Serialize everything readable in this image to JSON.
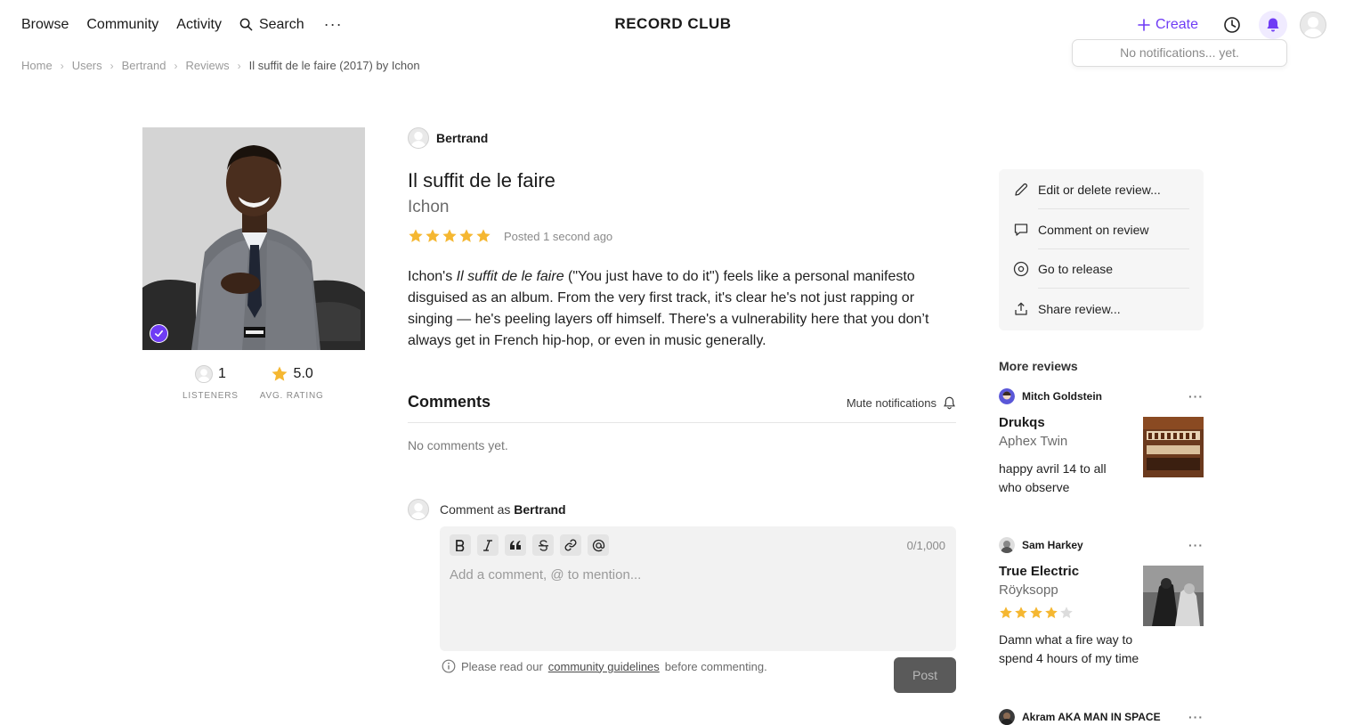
{
  "nav": {
    "browse": "Browse",
    "community": "Community",
    "activity": "Activity",
    "search": "Search",
    "more": "···",
    "logo": "RECORD CLUB",
    "create": "Create",
    "accent": "#6f3cf5"
  },
  "notifications": {
    "empty_text": "No notifications... yet."
  },
  "breadcrumb": {
    "home": "Home",
    "users": "Users",
    "user": "Bertrand",
    "reviews": "Reviews",
    "current": "Il suffit de le faire (2017) by Ichon"
  },
  "release": {
    "stats": {
      "listeners_count": "1",
      "listeners_label": "LISTENERS",
      "avg_rating": "5.0",
      "avg_rating_label": "AVG. RATING"
    }
  },
  "review": {
    "author": "Bertrand",
    "title": "Il suffit de le faire",
    "artist": "Ichon",
    "stars": 5,
    "posted": "Posted 1 second ago",
    "body_prefix": "Ichon's ",
    "body_italic": "Il suffit de le faire",
    "body_rest": " (\"You just have to do it\") feels like a personal manifesto disguised as an album. From the very first track, it's clear he's not just rapping or singing — he's peeling layers off himself. There's a vulnerability here that you don’t always get in French hip-hop, or even in music generally."
  },
  "comments": {
    "heading": "Comments",
    "mute": "Mute notifications",
    "empty": "No comments yet.",
    "comment_as_prefix": "Comment as",
    "comment_as_user": "Bertrand",
    "counter": "0/1,000",
    "placeholder": "Add a comment, @ to mention...",
    "guidelines_before": "Please read our",
    "guidelines_link": "community guidelines",
    "guidelines_after": "before commenting.",
    "post": "Post"
  },
  "actions": {
    "edit": "Edit or delete review...",
    "comment": "Comment on review",
    "release": "Go to release",
    "share": "Share review..."
  },
  "more_reviews": {
    "heading": "More reviews",
    "items": [
      {
        "user": "Mitch Goldstein",
        "title": "Drukqs",
        "artist": "Aphex Twin",
        "text": "happy avril 14 to all who observe"
      },
      {
        "user": "Sam Harkey",
        "title": "True Electric",
        "artist": "Röyksopp",
        "stars": 4,
        "text": "Damn what a fire way to spend 4 hours of my time"
      },
      {
        "user": "Akram AKA MAN IN SPACE"
      }
    ]
  }
}
